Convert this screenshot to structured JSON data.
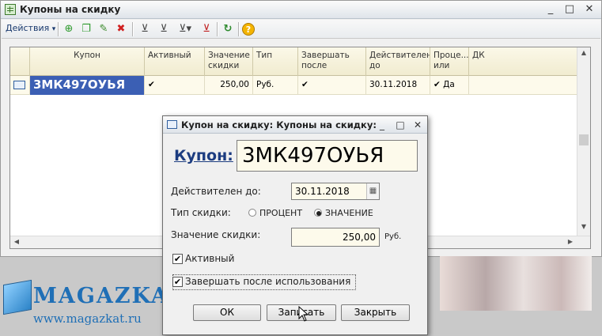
{
  "window": {
    "title": "Купоны на скидку",
    "controls": [
      "_",
      "□",
      "✕"
    ]
  },
  "toolbar": {
    "actions_label": "Действия",
    "actions_arrow": "▾",
    "icons": [
      "add-icon",
      "copy-icon",
      "edit-icon",
      "delete-icon",
      "filter-icon",
      "filter-selection-icon",
      "filter-dropdown-icon",
      "filter-clear-icon",
      "refresh-icon",
      "help-icon"
    ],
    "glyphs": {
      "add": "⊕",
      "copy": "❐",
      "edit": "✎",
      "delete": "✖",
      "filter": "⊻",
      "filter_selection": "⊻",
      "filter_dropdown": "⊻▾",
      "filter_clear": "⊻",
      "refresh": "↻",
      "help": "?"
    }
  },
  "grid": {
    "columns": [
      "",
      "Купон",
      "Активный",
      "Значение скидки",
      "Тип",
      "Завершать после",
      "Действителен до",
      "Проце... или",
      "ДК"
    ],
    "rows": [
      {
        "icon": "row-icon",
        "coupon": "3МК497ОУЬЯ",
        "active": "✔",
        "value": "250,00",
        "type": "Руб.",
        "finish_after": "✔",
        "valid_until": "30.11.2018",
        "percent": "✔ Да",
        "dk": ""
      }
    ]
  },
  "background": {
    "logo_text": "MAGAZKA",
    "logo_url": "www.magazkat.ru"
  },
  "dialog": {
    "title": "Купон на скидку: Купоны на скидку:",
    "controls": [
      "_",
      "□",
      "✕"
    ],
    "coupon_label": "Купон:",
    "coupon_value": "3МК497ОУЬЯ",
    "valid_until_label": "Действителен до:",
    "valid_until_value": "30.11.2018",
    "discount_type_label": "Тип скидки:",
    "discount_type_options": [
      "ПРОЦЕНТ",
      "ЗНАЧЕНИЕ"
    ],
    "discount_type_selected": "ЗНАЧЕНИЕ",
    "value_label": "Значение скидки:",
    "value_value": "250,00",
    "value_unit": "Руб.",
    "active_label": "Активный",
    "active_checked": true,
    "finish_after_use_label": "Завершать после использования",
    "finish_after_use_checked": true,
    "buttons": {
      "ok": "ОК",
      "save": "Записать",
      "close": "Закрыть"
    }
  }
}
